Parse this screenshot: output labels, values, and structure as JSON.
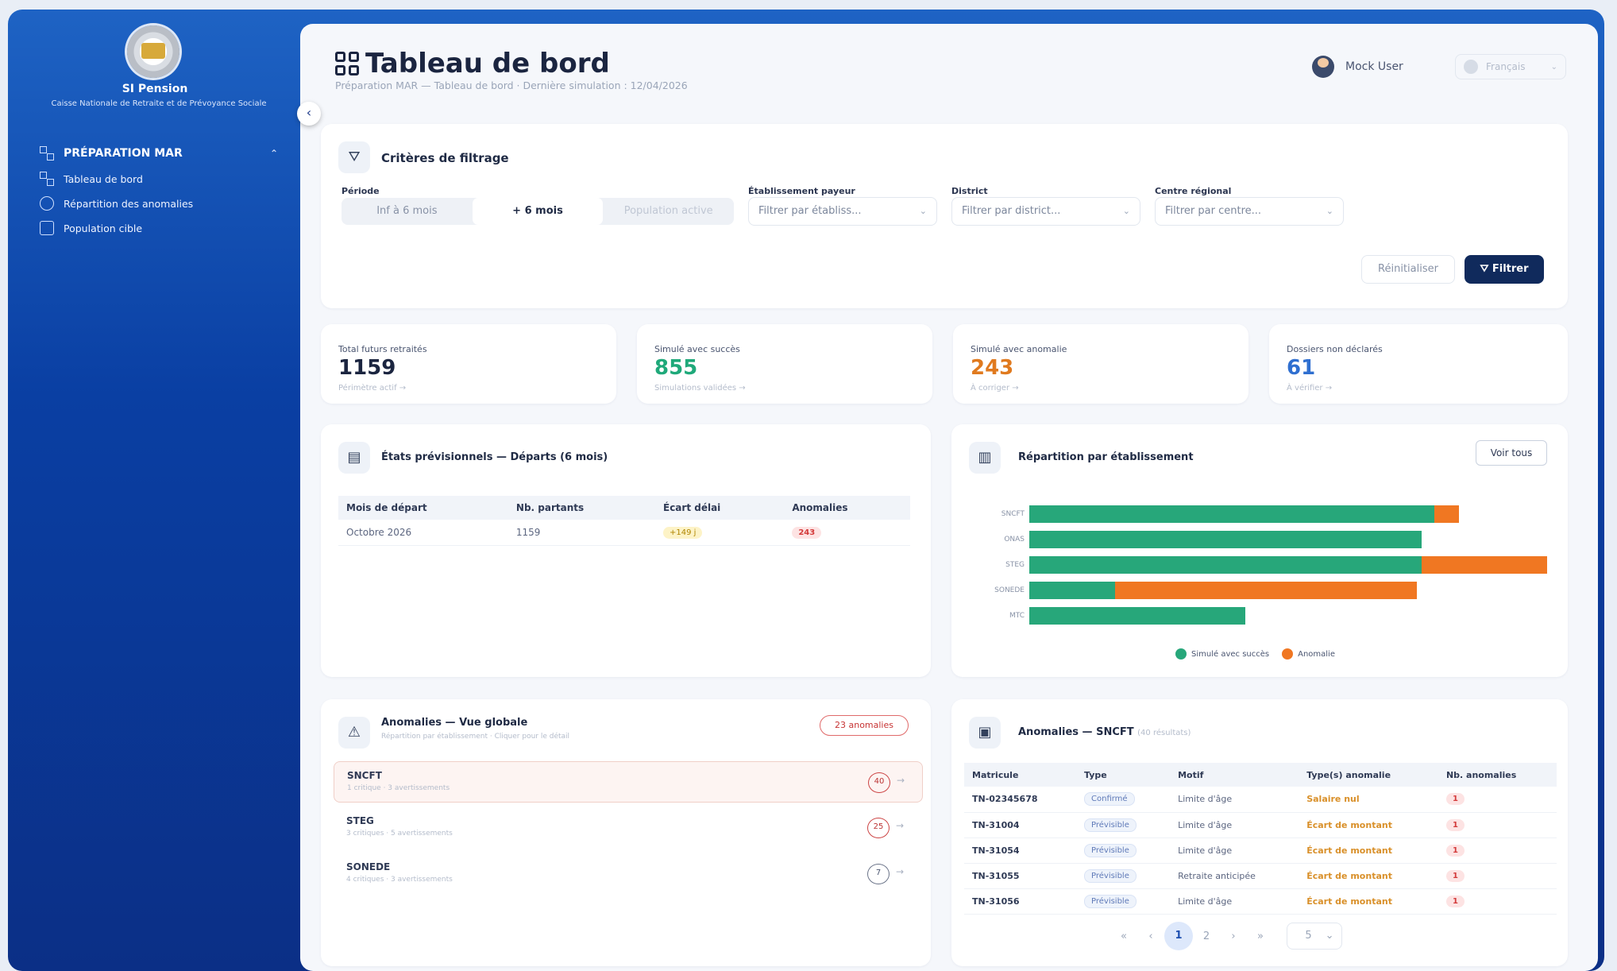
{
  "sidebar": {
    "brand_title": "SI Pension",
    "brand_subtitle": "Caisse Nationale de Retraite et de Prévoyance Sociale",
    "collapse_icon": "chevron-left-icon",
    "section_label": "PRÉPARATION MAR",
    "items": [
      {
        "label": "Tableau de bord",
        "icon": "grid-icon"
      },
      {
        "label": "Répartition des anomalies",
        "icon": "people-icon"
      },
      {
        "label": "Population cible",
        "icon": "calendar-icon"
      }
    ]
  },
  "header": {
    "title": "Tableau de bord",
    "subtitle": "Préparation MAR — Tableau de bord · Dernière simulation : 12/04/2026",
    "user_name": "Mock User",
    "language": "Français"
  },
  "filters": {
    "title": "Critères de filtrage",
    "period_label": "Période",
    "period_options": [
      "Inf à 6 mois",
      "+ 6 mois",
      "Population active"
    ],
    "period_selected": "+ 6 mois",
    "etab_label": "Établissement payeur",
    "etab_placeholder": "Filtrer par établiss...",
    "district_label": "District",
    "district_placeholder": "Filtrer par district...",
    "centre_label": "Centre régional",
    "centre_placeholder": "Filtrer par centre...",
    "reset_label": "Réinitialiser",
    "filter_label": "Filtrer"
  },
  "kpis": [
    {
      "label": "Total futurs retraités",
      "value": "1159",
      "sub": "Périmètre actif →",
      "color": "#1b2540"
    },
    {
      "label": "Simulé avec succès",
      "value": "855",
      "sub": "Simulations validées →",
      "color": "#1fa97a"
    },
    {
      "label": "Simulé avec anomalie",
      "value": "243",
      "sub": "À corriger →",
      "color": "#e07a1f"
    },
    {
      "label": "Dossiers non déclarés",
      "value": "61",
      "sub": "À vérifier →",
      "color": "#2f6fd0"
    }
  ],
  "previsionnels": {
    "title": "États prévisionnels — Départs (6 mois)",
    "columns": [
      "Mois de départ",
      "Nb. partants",
      "Écart délai",
      "Anomalies"
    ],
    "rows": [
      {
        "mois": "Octobre 2026",
        "partants": "1159",
        "ecart": "+149 j",
        "anomalies": "243"
      }
    ]
  },
  "repartition": {
    "title": "Répartition par établissement",
    "button": "Voir tous",
    "legend": [
      "Simulé avec succès",
      "Anomalie"
    ],
    "colors": {
      "success": "#27a77a",
      "anomaly": "#f07722"
    }
  },
  "chart_data": {
    "type": "bar",
    "orientation": "horizontal",
    "stacked": true,
    "categories": [
      "SNCFT",
      "ONAS",
      "STEG",
      "SONEDE",
      "MTC"
    ],
    "series": [
      {
        "name": "Simulé avec succès",
        "values": [
          330,
          320,
          320,
          70,
          176
        ]
      },
      {
        "name": "Anomalie",
        "values": [
          20,
          0,
          102,
          246,
          0
        ]
      }
    ],
    "xlim": [
      0,
      422
    ],
    "legend_position": "bottom"
  },
  "anomalies_global": {
    "title": "Anomalies — Vue globale",
    "subtitle": "Répartition par établissement · Cliquer pour le détail",
    "badge": "23 anomalies",
    "items": [
      {
        "name": "SNCFT",
        "sub": "1 critique · 3 avertissements",
        "count": "40",
        "selected": true
      },
      {
        "name": "STEG",
        "sub": "3 critiques · 5 avertissements",
        "count": "25",
        "selected": false
      },
      {
        "name": "SONEDE",
        "sub": "4 critiques · 3 avertissements",
        "count": "7",
        "selected": false
      }
    ]
  },
  "anomalies_sncft": {
    "title": "Anomalies — SNCFT",
    "results": "(40 résultats)",
    "columns": [
      "Matricule",
      "Type",
      "Motif",
      "Type(s) anomalie",
      "Nb. anomalies"
    ],
    "rows": [
      {
        "matricule": "TN-02345678",
        "type": "Confirmé",
        "motif": "Limite d'âge",
        "anomalie": "Salaire nul",
        "nb": "1"
      },
      {
        "matricule": "TN-31004",
        "type": "Prévisible",
        "motif": "Limite d'âge",
        "anomalie": "Écart de montant",
        "nb": "1"
      },
      {
        "matricule": "TN-31054",
        "type": "Prévisible",
        "motif": "Limite d'âge",
        "anomalie": "Écart de montant",
        "nb": "1"
      },
      {
        "matricule": "TN-31055",
        "type": "Prévisible",
        "motif": "Retraite anticipée",
        "anomalie": "Écart de montant",
        "nb": "1"
      },
      {
        "matricule": "TN-31056",
        "type": "Prévisible",
        "motif": "Limite d'âge",
        "anomalie": "Écart de montant",
        "nb": "1"
      }
    ],
    "pager": {
      "first": "«",
      "prev": "‹",
      "pages": [
        "1",
        "2"
      ],
      "current": "1",
      "next": "›",
      "last": "»",
      "page_size": "5"
    }
  }
}
